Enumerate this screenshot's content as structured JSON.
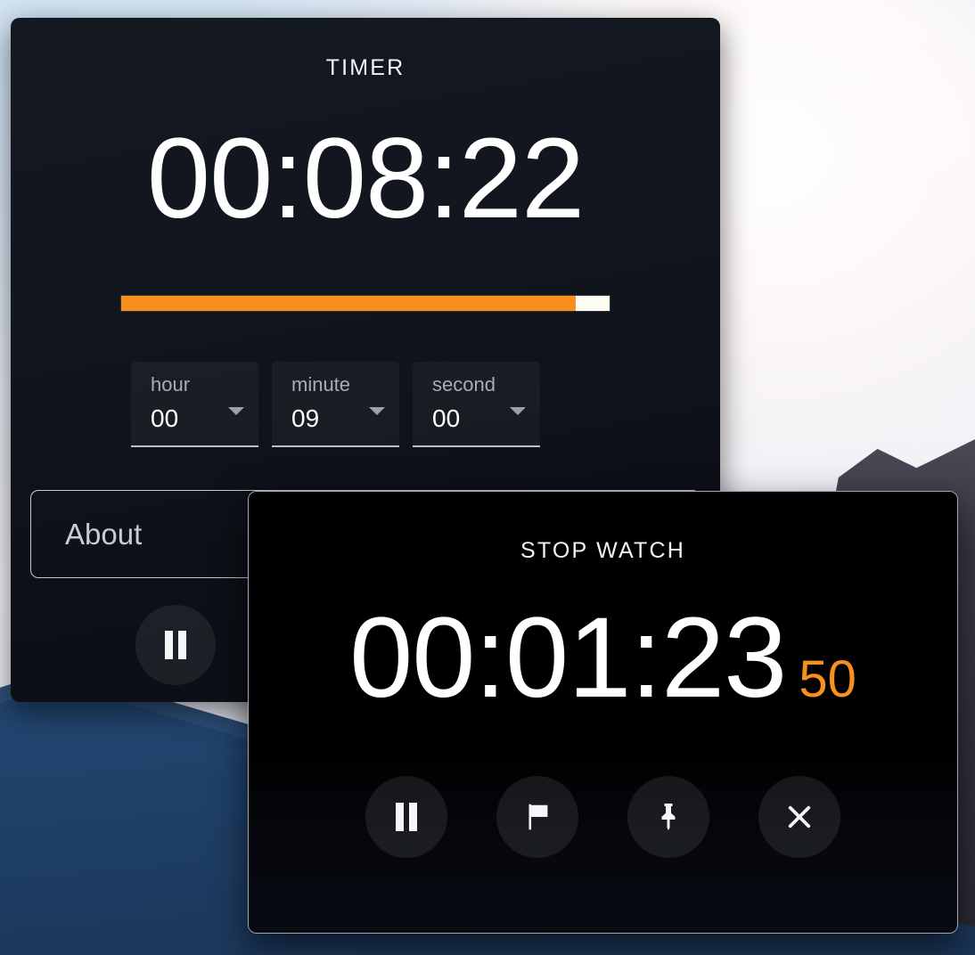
{
  "desktop": {
    "wallpaper_name": "mountain-landscape-wallpaper"
  },
  "timer": {
    "title": "TIMER",
    "clock": "00:08:22",
    "progress": {
      "percent": 93,
      "fill_color": "#f7901e",
      "track_color": "#fffdf3"
    },
    "selects": [
      {
        "label": "hour",
        "value": "00",
        "caret": "chevron-down-icon"
      },
      {
        "label": "minute",
        "value": "09",
        "caret": "chevron-down-icon"
      },
      {
        "label": "second",
        "value": "00",
        "caret": "chevron-down-icon"
      }
    ],
    "about_label": "About",
    "controls": [
      {
        "name": "pause-button",
        "icon": "pause-icon",
        "state": "active"
      },
      {
        "name": "reset-button",
        "icon": "reset-icon",
        "state": "ghosted"
      },
      {
        "name": "pin-button",
        "icon": "pin-icon",
        "state": "ghosted"
      },
      {
        "name": "close-button",
        "icon": "close-icon",
        "state": "ghosted"
      }
    ]
  },
  "stopwatch": {
    "title": "STOP WATCH",
    "clock": "00:01:23",
    "milliseconds": "50",
    "ms_color": "#f7901e",
    "controls": [
      {
        "name": "pause-button",
        "icon": "pause-icon"
      },
      {
        "name": "lap-button",
        "icon": "flag-icon"
      },
      {
        "name": "pin-button",
        "icon": "pin-icon"
      },
      {
        "name": "close-button",
        "icon": "close-icon"
      }
    ]
  }
}
